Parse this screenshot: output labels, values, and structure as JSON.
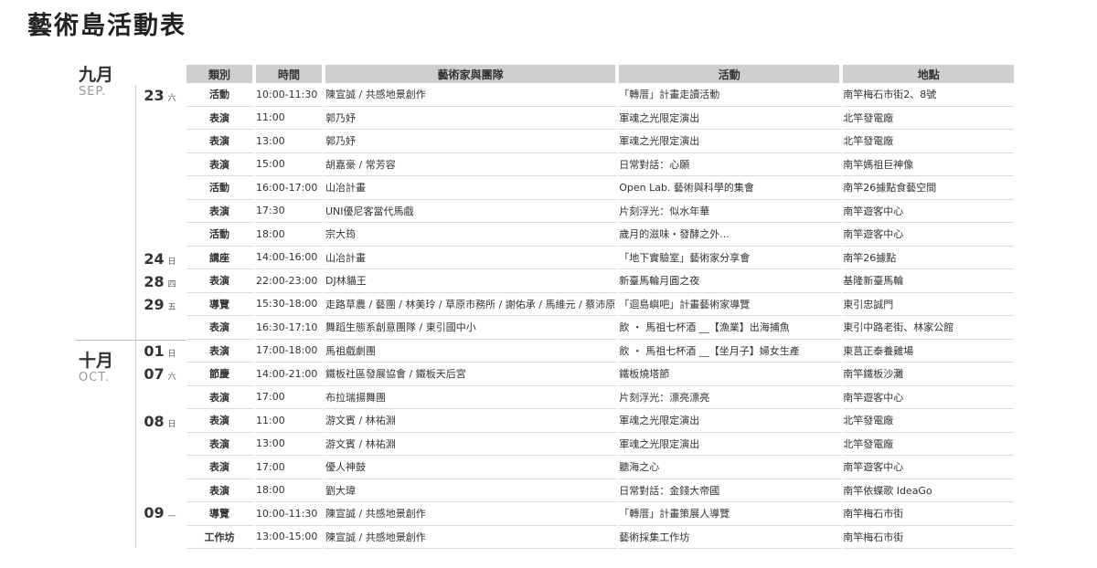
{
  "title": "藝術島活動表",
  "months": [
    {
      "zh": "九月",
      "en": "SEP."
    },
    {
      "zh": "十月",
      "en": "OCT."
    }
  ],
  "headers": {
    "type": "類別",
    "time": "時間",
    "artist": "藝術家與團隊",
    "activity": "活動",
    "place": "地點"
  },
  "days": [
    {
      "num": "23",
      "wk": "六"
    },
    {
      "num": "24",
      "wk": "日"
    },
    {
      "num": "28",
      "wk": "四"
    },
    {
      "num": "29",
      "wk": "五"
    },
    {
      "num": "01",
      "wk": "日"
    },
    {
      "num": "07",
      "wk": "六"
    },
    {
      "num": "08",
      "wk": "日"
    },
    {
      "num": "09",
      "wk": "—"
    }
  ],
  "rows": [
    {
      "type": "活動",
      "time": "10:00-11:30",
      "artist": "陳宣誠 / 共感地景創作",
      "activity": "「轉厝」計畫走讀活動",
      "place": "南竿梅石市街2、8號"
    },
    {
      "type": "表演",
      "time": "11:00",
      "artist": "郭乃妤",
      "activity": "軍魂之光限定演出",
      "place": "北竿發電廠"
    },
    {
      "type": "表演",
      "time": "13:00",
      "artist": "郭乃妤",
      "activity": "軍魂之光限定演出",
      "place": "北竿發電廠"
    },
    {
      "type": "表演",
      "time": "15:00",
      "artist": "胡嘉豪 / 常芳容",
      "activity": "日常對話：心願",
      "place": "南竿媽祖巨神像"
    },
    {
      "type": "活動",
      "time": "16:00-17:00",
      "artist": "山冶計畫",
      "activity": "Open Lab. 藝術與科學的集會",
      "place": "南竿26據點食藝空間"
    },
    {
      "type": "表演",
      "time": "17:30",
      "artist": "UNI優尼客當代馬戲",
      "activity": "片刻浮光：似水年華",
      "place": "南竿遊客中心"
    },
    {
      "type": "活動",
      "time": "18:00",
      "artist": "宗大筠",
      "activity": "歲月的滋味・發酵之外...",
      "place": "南竿遊客中心"
    },
    {
      "type": "講座",
      "time": "14:00-16:00",
      "artist": "山冶計畫",
      "activity": "「地下實驗室」藝術家分享會",
      "place": "南竿26據點"
    },
    {
      "type": "表演",
      "time": "22:00-23:00",
      "artist": "DJ林貓王",
      "activity": "新臺馬輪月圓之夜",
      "place": "基隆新臺馬輪"
    },
    {
      "type": "導覽",
      "time": "15:30-18:00",
      "artist": "走路草農 / 藝團 / 林美玲 / 草原市務所 / 謝佑承 / 馬維元 / 蔡沛原",
      "activity": "「迴島嶼吧」計畫藝術家導覽",
      "place": "東引忠誠門"
    },
    {
      "type": "表演",
      "time": "16:30-17:10",
      "artist": "舞蹈生態系創意團隊 / 東引國中小",
      "activity": "飲 ・ 馬祖七杯酒 __【漁業】出海捕魚",
      "place": "東引中路老街、林家公館"
    },
    {
      "type": "表演",
      "time": "17:00-18:00",
      "artist": "馬祖戲劇團",
      "activity": "飲 ・ 馬祖七杯酒 __【坐月子】婦女生產",
      "place": "東莒正泰養雞場"
    },
    {
      "type": "節慶",
      "time": "14:00-21:00",
      "artist": "鐵板社區發展協會 / 鐵板天后宮",
      "activity": "鐵板燒塔節",
      "place": "南竿鐵板沙灘"
    },
    {
      "type": "表演",
      "time": "17:00",
      "artist": "布拉瑞揚舞團",
      "activity": "片刻浮光：漂亮漂亮",
      "place": "南竿遊客中心"
    },
    {
      "type": "表演",
      "time": "11:00",
      "artist": "游文賓 / 林祐淵",
      "activity": "軍魂之光限定演出",
      "place": "北竿發電廠"
    },
    {
      "type": "表演",
      "time": "13:00",
      "artist": "游文賓 / 林祐淵",
      "activity": "軍魂之光限定演出",
      "place": "北竿發電廠"
    },
    {
      "type": "表演",
      "time": "17:00",
      "artist": "優人神鼓",
      "activity": "聽海之心",
      "place": "南竿遊客中心"
    },
    {
      "type": "表演",
      "time": "18:00",
      "artist": "劉大瑋",
      "activity": "日常對話：金錢大帝國",
      "place": "南竿依蝶歌 IdeaGo"
    },
    {
      "type": "導覽",
      "time": "10:00-11:30",
      "artist": "陳宣誠 / 共感地景創作",
      "activity": "「轉厝」計畫策展人導覽",
      "place": "南竿梅石市街"
    },
    {
      "type": "工作坊",
      "time": "13:00-15:00",
      "artist": "陳宣誠 / 共感地景創作",
      "activity": "藝術採集工作坊",
      "place": "南竿梅石市街"
    }
  ]
}
